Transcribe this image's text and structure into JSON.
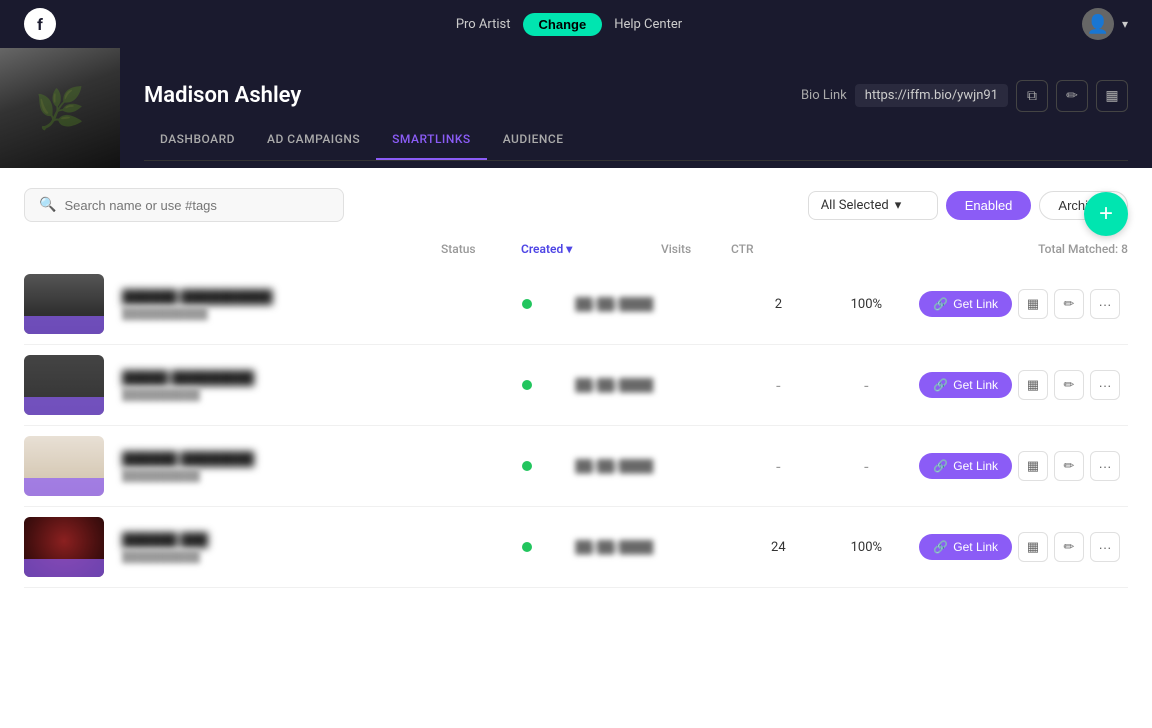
{
  "topNav": {
    "logo": "f",
    "proLabel": "Pro Artist",
    "changeBtn": "Change",
    "helpCenter": "Help Center",
    "chevron": "▾"
  },
  "profile": {
    "name": "Madison Ashley",
    "bioLinkLabel": "Bio Link",
    "bioLinkUrl": "https://iffm.bio/ywjn91",
    "tabs": [
      {
        "id": "dashboard",
        "label": "DASHBOARD"
      },
      {
        "id": "ad-campaigns",
        "label": "AD CAMPAIGNS"
      },
      {
        "id": "smartlinks",
        "label": "SMARTLINKS",
        "active": true
      },
      {
        "id": "audience",
        "label": "AUDIENCE"
      }
    ]
  },
  "toolbar": {
    "addBtn": "+",
    "searchPlaceholder": "Search name or use #tags",
    "filterOptions": [
      "All Selected"
    ],
    "filterDropdownArrow": "▾",
    "enabledBtn": "Enabled",
    "archivedBtn": "Archived",
    "totalMatched": "Total Matched: 8",
    "statusCol": "Status",
    "createdCol": "Created",
    "sortArrow": "▾",
    "visitsCol": "Visits",
    "ctrCol": "CTR"
  },
  "rows": [
    {
      "id": 1,
      "name": "██████ ██████",
      "sub": "██████████",
      "status": "active",
      "date": "██/██/████",
      "visits": "2",
      "ctr": "100%",
      "getLinkLabel": "Get Link",
      "thumbClass": "thumb-1"
    },
    {
      "id": 2,
      "name": "█████ █████████",
      "sub": "██████████",
      "status": "active",
      "date": "██/██/████",
      "visits": "-",
      "ctr": "-",
      "getLinkLabel": "Get Link",
      "thumbClass": "thumb-2"
    },
    {
      "id": 3,
      "name": "██████ ███████",
      "sub": "██████████",
      "status": "active",
      "date": "██/██/████",
      "visits": "-",
      "ctr": "-",
      "getLinkLabel": "Get Link",
      "thumbClass": "thumb-3"
    },
    {
      "id": 4,
      "name": "██████ ███",
      "sub": "██████████",
      "status": "active",
      "date": "██/██/████",
      "visits": "24",
      "ctr": "100%",
      "getLinkLabel": "Get Link",
      "thumbClass": "thumb-4"
    }
  ],
  "icons": {
    "search": "🔍",
    "copy": "⧉",
    "edit": "✏",
    "stats": "📊",
    "link": "🔗",
    "more": "•••",
    "barChart": "▦"
  }
}
